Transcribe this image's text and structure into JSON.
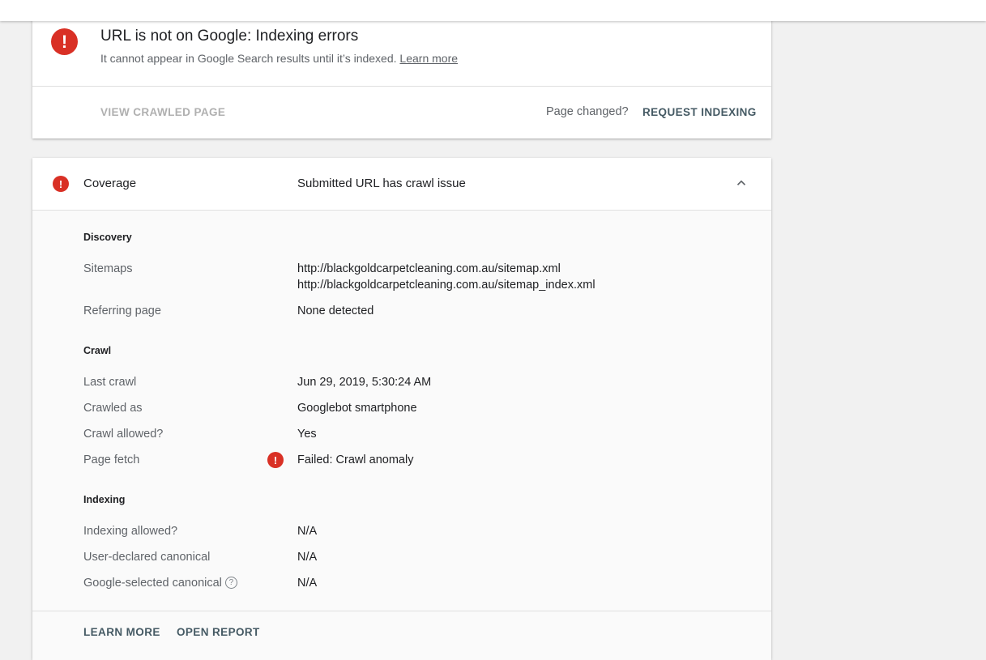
{
  "status_card": {
    "title": "URL is not on Google: Indexing errors",
    "subtitle": "It cannot appear in Google Search results until it’s indexed.",
    "learn_more_link": "Learn more",
    "view_crawled_page": "VIEW CRAWLED PAGE",
    "page_changed": "Page changed?",
    "request_indexing": "REQUEST INDEXING",
    "error_icon": "error-exclamation-icon"
  },
  "coverage": {
    "label": "Coverage",
    "value": "Submitted URL has crawl issue",
    "expanded_icon": "chevron-up-icon",
    "sections": {
      "discovery": {
        "heading": "Discovery",
        "sitemaps_label": "Sitemaps",
        "sitemaps": [
          "http://blackgoldcarpetcleaning.com.au/sitemap.xml",
          "http://blackgoldcarpetcleaning.com.au/sitemap_index.xml"
        ],
        "referring_label": "Referring page",
        "referring_value": "None detected"
      },
      "crawl": {
        "heading": "Crawl",
        "last_crawl_label": "Last crawl",
        "last_crawl_value": "Jun 29, 2019, 5:30:24 AM",
        "crawled_as_label": "Crawled as",
        "crawled_as_value": "Googlebot smartphone",
        "crawl_allowed_label": "Crawl allowed?",
        "crawl_allowed_value": "Yes",
        "page_fetch_label": "Page fetch",
        "page_fetch_value": "Failed: Crawl anomaly"
      },
      "indexing": {
        "heading": "Indexing",
        "indexing_allowed_label": "Indexing allowed?",
        "indexing_allowed_value": "N/A",
        "user_canonical_label": "User-declared canonical",
        "user_canonical_value": "N/A",
        "google_canonical_label": "Google-selected canonical",
        "google_canonical_value": "N/A"
      }
    },
    "footer": {
      "learn_more": "LEARN MORE",
      "open_report": "OPEN REPORT"
    }
  },
  "colors": {
    "error_red": "#d93025",
    "action_dark": "#455a64",
    "background": "#f1f1f1"
  }
}
